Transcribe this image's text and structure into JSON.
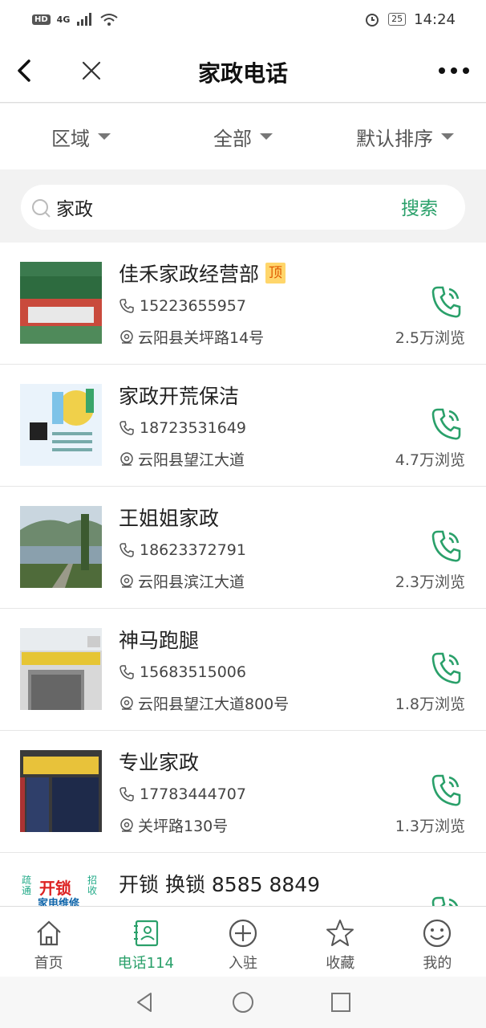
{
  "status_bar": {
    "hd": "HD",
    "signal": "4G",
    "time": "14:24",
    "battery": "25"
  },
  "nav": {
    "title": "家政电话"
  },
  "filters": [
    {
      "label": "区域"
    },
    {
      "label": "全部"
    },
    {
      "label": "默认排序"
    }
  ],
  "search": {
    "value": "家政",
    "button": "搜索"
  },
  "listings": [
    {
      "name": "佳禾家政经营部",
      "badge": "顶",
      "phone": "15223655957",
      "address": "云阳县关坪路14号",
      "views": "2.5万浏览",
      "thumb": "shop-sign"
    },
    {
      "name": "家政开荒保洁",
      "phone": "18723531649",
      "address": "云阳县望江大道",
      "views": "4.7万浏览",
      "thumb": "cleaning-flyer"
    },
    {
      "name": "王姐姐家政",
      "phone": "18623372791",
      "address": "云阳县滨江大道",
      "views": "2.3万浏览",
      "thumb": "lake-photo"
    },
    {
      "name": "神马跑腿",
      "phone": "15683515006",
      "address": "云阳县望江大道800号",
      "views": "1.8万浏览",
      "thumb": "storefront"
    },
    {
      "name": "专业家政",
      "phone": "17783444707",
      "address": "关坪路130号",
      "views": "1.3万浏览",
      "thumb": "shop-front"
    },
    {
      "name": "开锁 换锁 8585 8849",
      "phone": "",
      "address": "",
      "views": "",
      "thumb": "lock-sign"
    }
  ],
  "thumb_texts": {
    "lock_line1": "开锁",
    "lock_line2": "家电维修",
    "lock_side_left": "疏通",
    "lock_side_right": "招收"
  },
  "tabs": [
    {
      "label": "首页",
      "icon": "home-icon"
    },
    {
      "label": "电话114",
      "icon": "phonebook-icon",
      "active": true
    },
    {
      "label": "入驻",
      "icon": "plus-circle-icon"
    },
    {
      "label": "收藏",
      "icon": "star-icon"
    },
    {
      "label": "我的",
      "icon": "smiley-icon"
    }
  ],
  "colors": {
    "accent": "#2aa06a",
    "badge_bg": "#ffd66b",
    "badge_text": "#e05a00"
  }
}
